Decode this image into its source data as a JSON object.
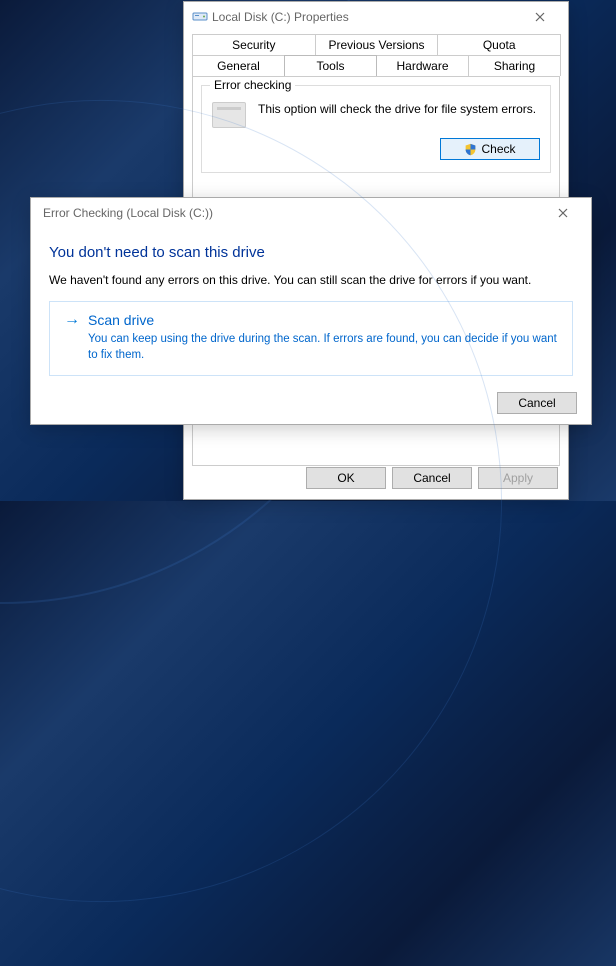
{
  "props": {
    "title": "Local Disk (C:) Properties",
    "tabs_row1": [
      "Security",
      "Previous Versions",
      "Quota"
    ],
    "tabs_row2": [
      "General",
      "Tools",
      "Hardware",
      "Sharing"
    ],
    "active_tab": "Tools",
    "group_title": "Error checking",
    "group_desc": "This option will check the drive for file system errors.",
    "check_btn": "Check",
    "ok": "OK",
    "cancel": "Cancel",
    "apply": "Apply"
  },
  "errchk": {
    "title": "Error Checking (Local Disk (C:))",
    "headline": "You don't need to scan this drive",
    "subtext": "We haven't found any errors on this drive. You can still scan the drive for errors if you want.",
    "option_title": "Scan drive",
    "option_desc": "You can keep using the drive during the scan. If errors are found, you can decide if you want to fix them.",
    "cancel": "Cancel"
  }
}
